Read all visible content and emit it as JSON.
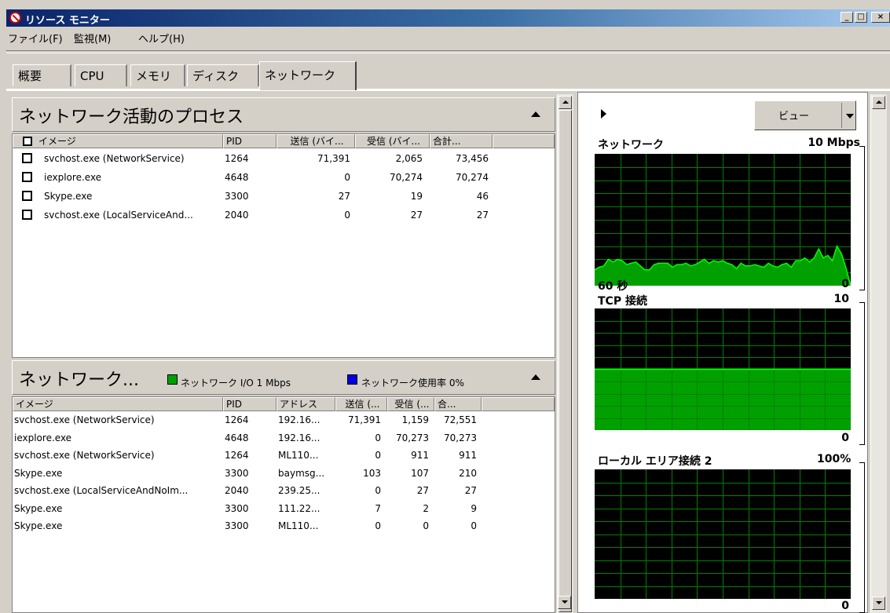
{
  "window": {
    "title": "リソース モニター",
    "min_label": "_",
    "max_label": "□",
    "close_label": "×"
  },
  "menu": [
    "ファイル(F)",
    "監視(M)",
    "ヘルプ(H)"
  ],
  "tabs": [
    "概要",
    "CPU",
    "メモリ",
    "ディスク",
    "ネットワーク"
  ],
  "active_tab": "ネットワーク",
  "processes_section": {
    "title": "ネットワーク活動のプロセス",
    "columns": [
      "イメージ",
      "PID",
      "送信 (バイ...",
      "受信 (バイ...",
      "合計..."
    ],
    "rows": [
      {
        "image": "svchost.exe (NetworkService)",
        "pid": "1264",
        "send": "71,391",
        "recv": "2,065",
        "total": "73,456"
      },
      {
        "image": "iexplore.exe",
        "pid": "4648",
        "send": "0",
        "recv": "70,274",
        "total": "70,274"
      },
      {
        "image": "Skype.exe",
        "pid": "3300",
        "send": "27",
        "recv": "19",
        "total": "46"
      },
      {
        "image": "svchost.exe (LocalServiceAnd...",
        "pid": "2040",
        "send": "0",
        "recv": "27",
        "total": "27"
      }
    ]
  },
  "network_section": {
    "title": "ネットワーク...",
    "legend_io": "ネットワーク I/O 1 Mbps",
    "legend_usage": "ネットワーク使用率 0%",
    "legend_io_color": "#00a000",
    "legend_usage_color": "#0000e0",
    "columns": [
      "イメージ",
      "PID",
      "アドレス",
      "送信 (...",
      "受信 (...",
      "合..."
    ],
    "rows": [
      {
        "image": "svchost.exe (NetworkService)",
        "pid": "1264",
        "addr": "192.16...",
        "send": "71,391",
        "recv": "1,159",
        "total": "72,551"
      },
      {
        "image": "iexplore.exe",
        "pid": "4648",
        "addr": "192.16...",
        "send": "0",
        "recv": "70,273",
        "total": "70,273"
      },
      {
        "image": "svchost.exe (NetworkService)",
        "pid": "1264",
        "addr": "ML110...",
        "send": "0",
        "recv": "911",
        "total": "911"
      },
      {
        "image": "Skype.exe",
        "pid": "3300",
        "addr": "baymsg...",
        "send": "103",
        "recv": "107",
        "total": "210"
      },
      {
        "image": "svchost.exe (LocalServiceAndNoIm...",
        "pid": "2040",
        "addr": "239.25...",
        "send": "0",
        "recv": "27",
        "total": "27"
      },
      {
        "image": "Skype.exe",
        "pid": "3300",
        "addr": "111.22...",
        "send": "7",
        "recv": "2",
        "total": "9"
      },
      {
        "image": "Skype.exe",
        "pid": "3300",
        "addr": "ML110...",
        "send": "0",
        "recv": "0",
        "total": "0"
      }
    ]
  },
  "right_panel": {
    "view_label": "ビュー",
    "graphs": [
      {
        "title": "ネットワーク",
        "scale_max": "10 Mbps",
        "time_label": "60 秒",
        "scale_min": "0"
      },
      {
        "title": "TCP 接続",
        "scale_max": "10",
        "scale_min": "0",
        "fill_fraction": 0.5
      },
      {
        "title": "ローカル エリア接続 2",
        "scale_max": "100%",
        "scale_min": "0"
      }
    ],
    "network_series": [
      0.12,
      0.14,
      0.15,
      0.2,
      0.18,
      0.2,
      0.19,
      0.16,
      0.17,
      0.18,
      0.15,
      0.12,
      0.12,
      0.16,
      0.17,
      0.17,
      0.17,
      0.14,
      0.16,
      0.16,
      0.17,
      0.15,
      0.16,
      0.18,
      0.2,
      0.17,
      0.19,
      0.18,
      0.19,
      0.17,
      0.16,
      0.13,
      0.17,
      0.15,
      0.15,
      0.16,
      0.15,
      0.14,
      0.17,
      0.15,
      0.14,
      0.16,
      0.17,
      0.14,
      0.19,
      0.19,
      0.21,
      0.18,
      0.21,
      0.28,
      0.21,
      0.23,
      0.19,
      0.3,
      0.24,
      0.13,
      0.0
    ],
    "colors": {
      "grid": "#008000",
      "line": "#00ff00",
      "fill": "#00a000"
    }
  }
}
